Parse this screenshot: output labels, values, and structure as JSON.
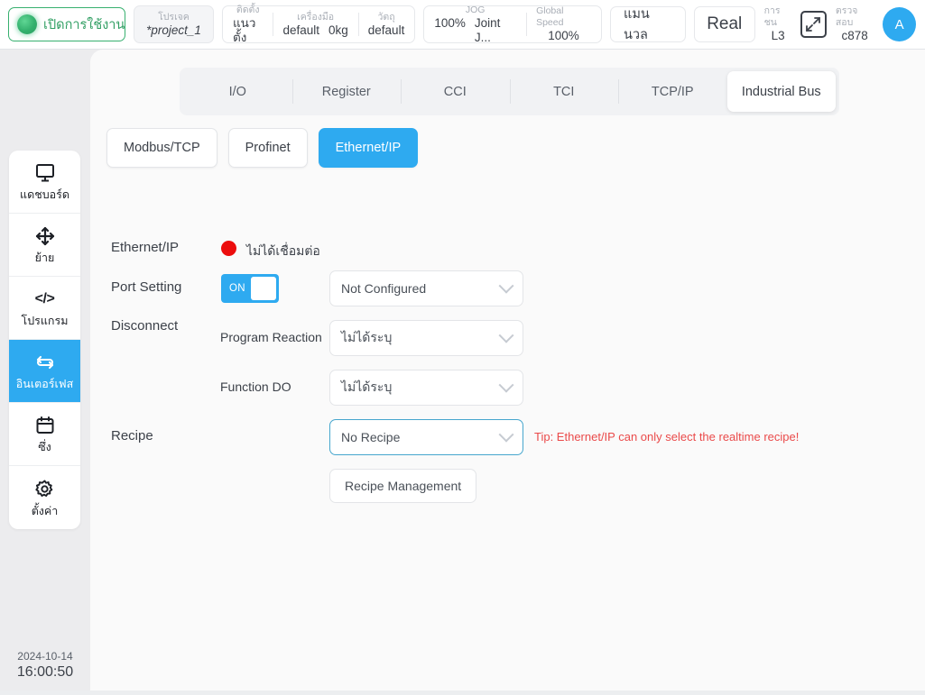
{
  "topbar": {
    "enable_button": {
      "label": "เปิดการใช้งาน",
      "icon": "status-dot-green",
      "color": "#2f9e62"
    },
    "project": {
      "caption": "โปรเจค",
      "value": "*project_1"
    },
    "mount": {
      "caption": "ติดตั้ง",
      "value": "แนวตั้ง"
    },
    "tool": {
      "caption": "เครื่องมือ",
      "value": "default",
      "payload": "0kg"
    },
    "object": {
      "caption": "วัตถุ",
      "value": "default"
    },
    "jog": {
      "caption": "JOG",
      "speed": "100%",
      "mode": "Joint J..."
    },
    "global_speed": {
      "caption": "Global Speed",
      "value": "100%"
    },
    "manual_button": "แมนนวล",
    "real_button": "Real",
    "collision": {
      "caption": "การชน",
      "value": "L3"
    },
    "expand_icon": "expand-arrows-icon",
    "check": {
      "caption": "ตรวจสอบ",
      "value": "c878"
    },
    "avatar_letter": "A",
    "accent": "#2eaaf0"
  },
  "sidebar": {
    "items": [
      {
        "icon": "monitor-icon",
        "label": "แดชบอร์ด",
        "active": false
      },
      {
        "icon": "move-arrows-icon",
        "label": "ย้าย",
        "active": false
      },
      {
        "icon": "code-icon",
        "label": "โปรแกรม",
        "active": false
      },
      {
        "icon": "interface-sync-icon",
        "label": "อินเตอร์เฟส",
        "active": true
      },
      {
        "icon": "calendar-icon",
        "label": "ซึ่ง",
        "active": false
      },
      {
        "icon": "gear-icon",
        "label": "ตั้งค่า",
        "active": false
      }
    ],
    "clock": {
      "date": "2024-10-14",
      "time": "16:00:50"
    }
  },
  "tabs": [
    {
      "label": "I/O",
      "active": false
    },
    {
      "label": "Register",
      "active": false
    },
    {
      "label": "CCI",
      "active": false
    },
    {
      "label": "TCI",
      "active": false
    },
    {
      "label": "TCP/IP",
      "active": false
    },
    {
      "label": "Industrial Bus",
      "active": true
    }
  ],
  "subtabs": [
    {
      "label": "Modbus/TCP",
      "active": false
    },
    {
      "label": "Profinet",
      "active": false
    },
    {
      "label": "Ethernet/IP",
      "active": true
    }
  ],
  "form": {
    "ethernet_ip": {
      "label": "Ethernet/IP",
      "status_text": "ไม่ได้เชื่อมต่อ",
      "status_color": "#ec0d0d"
    },
    "port_setting": {
      "label": "Port Setting",
      "toggle_state": "ON",
      "select_value": "Not Configured"
    },
    "disconnect": {
      "label": "Disconnect"
    },
    "program_reaction": {
      "label": "Program Reaction",
      "value": "ไม่ได้ระบุ"
    },
    "function_do": {
      "label": "Function DO",
      "value": "ไม่ได้ระบุ"
    },
    "recipe": {
      "label": "Recipe",
      "value": "No Recipe",
      "tip": "Tip: Ethernet/IP can only select the realtime recipe!",
      "tip_color": "#ea4a4a"
    },
    "recipe_management_button": "Recipe Management"
  }
}
